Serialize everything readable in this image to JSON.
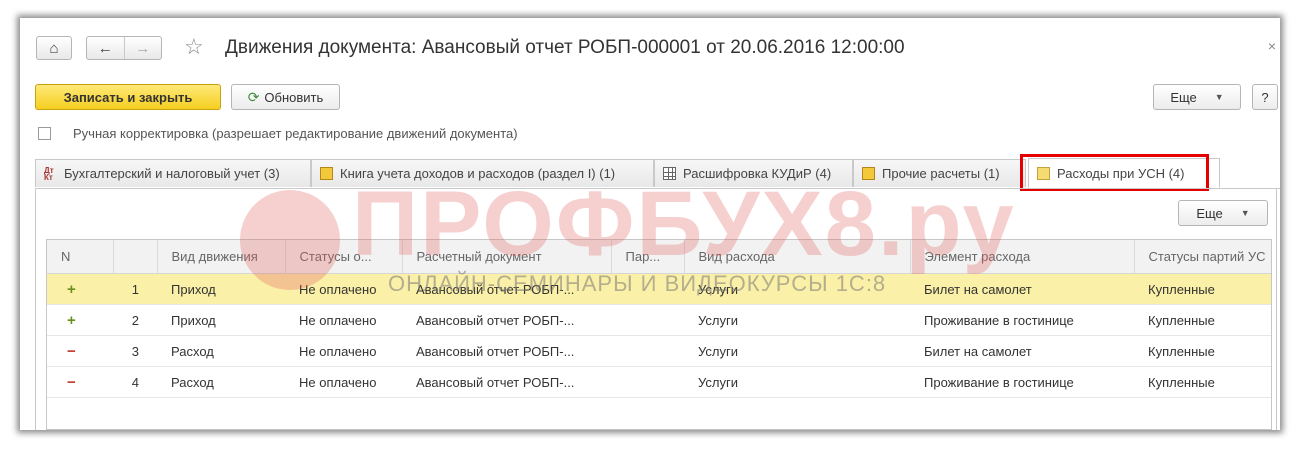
{
  "window": {
    "title": "Движения документа: Авансовый отчет РОБП-000001 от 20.06.2016 12:00:00",
    "close_glyph": "×"
  },
  "nav": {
    "home_glyph": "⌂",
    "back_glyph": "←",
    "forward_glyph": "→",
    "favorite_glyph": "☆"
  },
  "toolbar": {
    "save_close_label": "Записать и закрыть",
    "refresh_label": "Обновить",
    "more_label": "Еще",
    "help_label": "?"
  },
  "manual_edit": {
    "label": "Ручная корректировка (разрешает редактирование движений документа)",
    "checked": false
  },
  "tabs": [
    {
      "label": "Бухгалтерский и налоговый учет (3)",
      "icon": "dt-kt-icon"
    },
    {
      "label": "Книга учета доходов и расходов (раздел I) (1)",
      "icon": "register-book-icon"
    },
    {
      "label": "Расшифровка КУДиР (4)",
      "icon": "table-grid-icon"
    },
    {
      "label": "Прочие расчеты (1)",
      "icon": "register-book-icon"
    },
    {
      "label": "Расходы при УСН (4)",
      "icon": "register-book-icon",
      "active": true
    }
  ],
  "tab_toolbar": {
    "more_label": "Еще"
  },
  "table": {
    "columns": [
      "N",
      "",
      "Вид движения",
      "Статусы о...",
      "Расчетный документ",
      "Пар...",
      "Вид расхода",
      "Элемент расхода",
      "Статусы партий УС"
    ],
    "rows": [
      {
        "sign": "+",
        "n": "1",
        "movement": "Приход",
        "status": "Не оплачено",
        "doc": "Авансовый отчет РОБП-...",
        "part": "",
        "kind": "Услуги",
        "element": "Билет на самолет",
        "batch_status": "Купленные",
        "selected": true
      },
      {
        "sign": "+",
        "n": "2",
        "movement": "Приход",
        "status": "Не оплачено",
        "doc": "Авансовый отчет РОБП-...",
        "part": "",
        "kind": "Услуги",
        "element": "Проживание в гостинице",
        "batch_status": "Купленные"
      },
      {
        "sign": "−",
        "n": "3",
        "movement": "Расход",
        "status": "Не оплачено",
        "doc": "Авансовый отчет РОБП-...",
        "part": "",
        "kind": "Услуги",
        "element": "Билет на самолет",
        "batch_status": "Купленные"
      },
      {
        "sign": "−",
        "n": "4",
        "movement": "Расход",
        "status": "Не оплачено",
        "doc": "Авансовый отчет РОБП-...",
        "part": "",
        "kind": "Услуги",
        "element": "Проживание в гостинице",
        "batch_status": "Купленные"
      }
    ]
  },
  "watermark": {
    "brand": "ПРОФБУХ8.ру",
    "tagline": "ОНЛАЙН-СЕМИНАРЫ И ВИДЕОКУРСЫ 1С:8"
  },
  "colors": {
    "save_button": "#f5cf1f",
    "selected_row": "#fbf0a7",
    "highlight_frame": "#e40000",
    "plus_sign": "#6b8f1a",
    "minus_sign": "#c0392b"
  }
}
